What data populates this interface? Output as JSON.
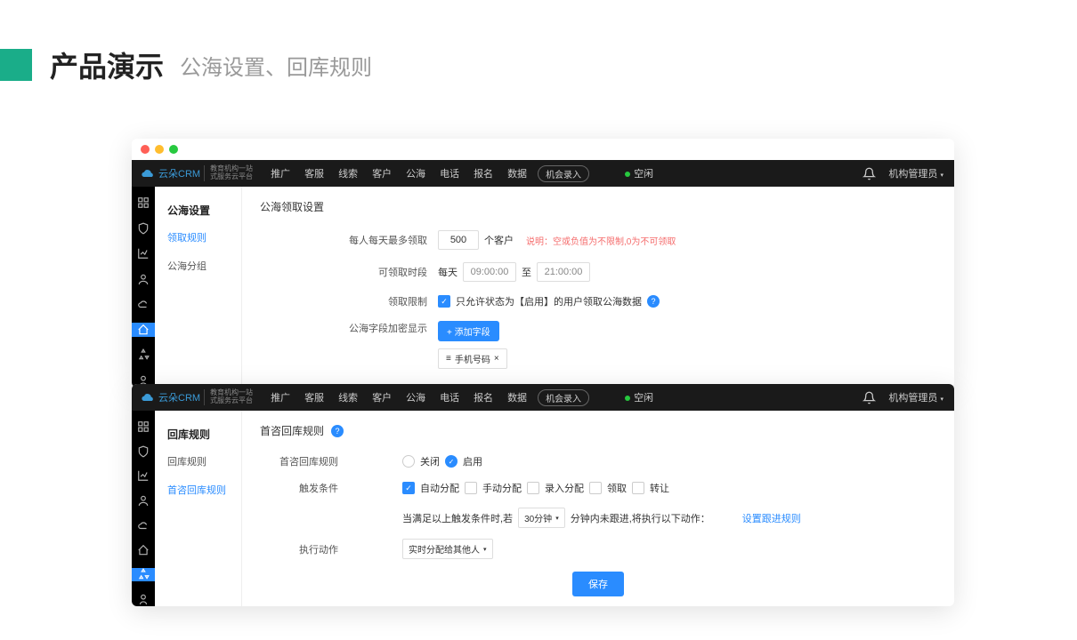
{
  "slide": {
    "title": "产品演示",
    "subtitle": "公海设置、回库规则"
  },
  "logo_text": "云朵CRM",
  "logo_sub1": "教育机构一站",
  "logo_sub2": "式服务云平台",
  "topnav": {
    "items": [
      "推广",
      "客服",
      "线索",
      "客户",
      "公海",
      "电话",
      "报名",
      "数据"
    ],
    "record_btn": "机会录入",
    "status": "空闲",
    "user": "机构管理员"
  },
  "win1": {
    "side_title": "公海设置",
    "side_items": [
      "领取规则",
      "公海分组"
    ],
    "content_title": "公海领取设置",
    "row1": {
      "label": "每人每天最多领取",
      "value": "500",
      "suffix": "个客户",
      "hint": "说明：空或负值为不限制,0为不可领取"
    },
    "row2": {
      "label": "可领取时段",
      "prefix": "每天",
      "from": "09:00:00",
      "to_label": "至",
      "to": "21:00:00"
    },
    "row3": {
      "label": "领取限制",
      "text": "只允许状态为【启用】的用户领取公海数据"
    },
    "row4": {
      "label": "公海字段加密显示",
      "btn": "+ 添加字段",
      "tag": "手机号码"
    }
  },
  "win2": {
    "side_title": "回库规则",
    "side_items": [
      "回库规则",
      "首咨回库规则"
    ],
    "content_title": "首咨回库规则",
    "row1": {
      "label": "首咨回库规则",
      "off": "关闭",
      "on": "启用"
    },
    "row2": {
      "label": "触发条件",
      "opts": [
        "自动分配",
        "手动分配",
        "录入分配",
        "领取",
        "转让"
      ]
    },
    "row3": {
      "pre": "当满足以上触发条件时,若",
      "select": "30分钟",
      "mid": "分钟内未跟进,将执行以下动作：",
      "link": "设置跟进规则"
    },
    "row4": {
      "label": "执行动作",
      "select": "实时分配给其他人"
    },
    "save": "保存"
  }
}
